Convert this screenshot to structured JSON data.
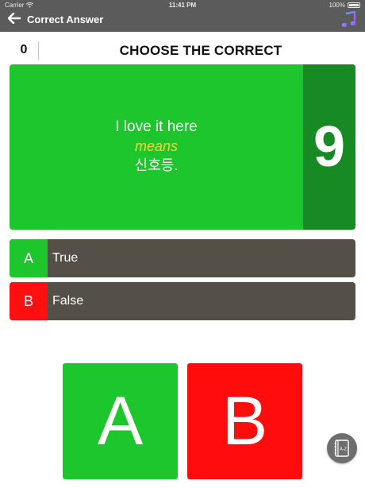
{
  "status_bar": {
    "carrier": "Carrier",
    "time": "11:41 PM",
    "battery": "100%"
  },
  "nav": {
    "title": "Correct Answer",
    "back_icon": "arrow-left-icon",
    "music_icon": "music-note-icon"
  },
  "header": {
    "score": "0",
    "title": "CHOOSE THE CORRECT"
  },
  "question": {
    "phrase": "I love it here",
    "means": "means",
    "answer": "신호등."
  },
  "timer": {
    "value": "9"
  },
  "options": [
    {
      "letter": "A",
      "text": "True",
      "color": "#1ec62e"
    },
    {
      "letter": "B",
      "text": "False",
      "color": "#ff1010"
    }
  ],
  "buttons": {
    "a_label": "A",
    "b_label": "B"
  },
  "dictionary": {
    "icon": "dictionary-book-icon",
    "label": "A-Z"
  },
  "colors": {
    "nav_bg": "#5b5b5b",
    "green": "#1ec62e",
    "dark_green": "#178a24",
    "red": "#ff0d0d",
    "option_bg": "#545048",
    "means_yellow": "#f2d53c"
  }
}
